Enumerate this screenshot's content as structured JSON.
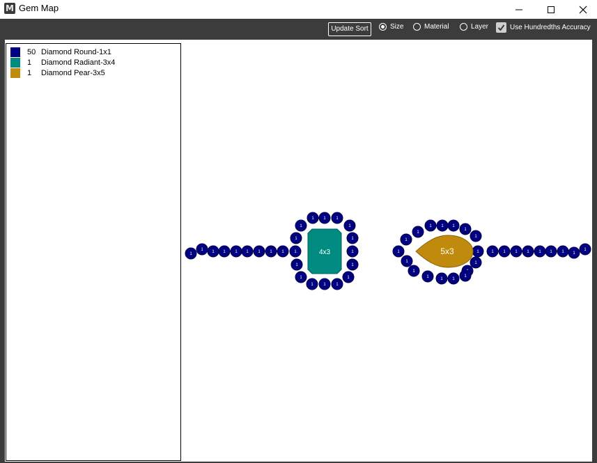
{
  "window": {
    "title": "Gem Map",
    "logo_letter": "M"
  },
  "toolbar": {
    "update_label": "Update Sort",
    "radios": [
      {
        "label": "Size",
        "selected": true
      },
      {
        "label": "Material",
        "selected": false
      },
      {
        "label": "Layer",
        "selected": false
      }
    ],
    "checkbox_label": "Use Hundredths Accuracy",
    "checkbox_checked": true
  },
  "legend": [
    {
      "count": "50",
      "name": "Diamond Round-1x1",
      "color": "#000080"
    },
    {
      "count": "1",
      "name": "Diamond Radiant-3x4",
      "color": "#008B80"
    },
    {
      "count": "1",
      "name": "Diamond Pear-3x5",
      "color": "#C08A0C"
    }
  ],
  "gems": {
    "round_label": "1",
    "radiant_label": "4x3",
    "pear_label": "5x3",
    "round_color": "#000080",
    "radiant_color": "#008B80",
    "pear_color": "#C08A0C"
  }
}
